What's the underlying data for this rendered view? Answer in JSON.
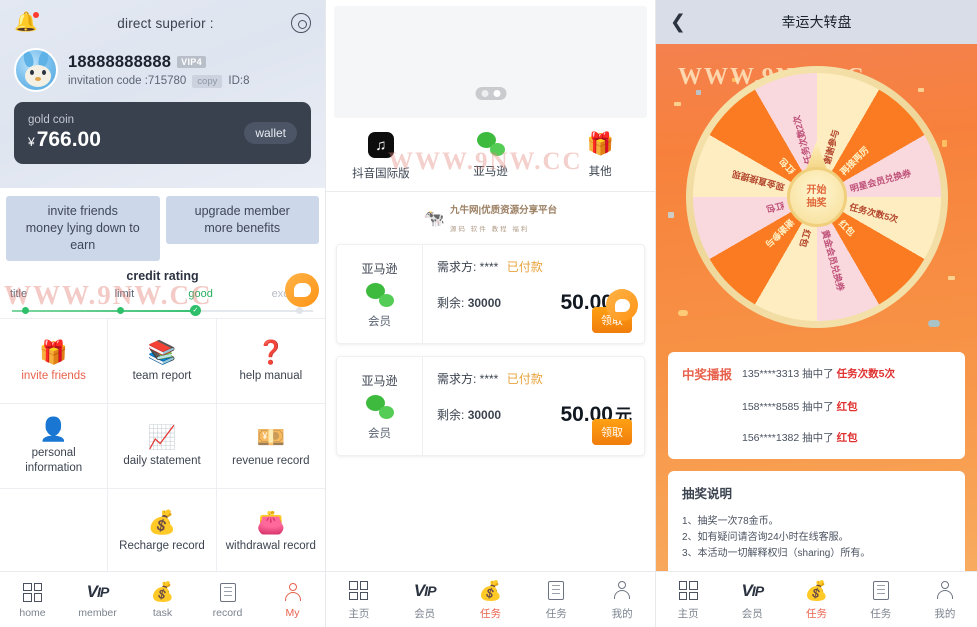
{
  "panel1": {
    "topbar": {
      "title": "direct superior :",
      "bell_icon": "bell-icon",
      "gear_icon": "gear-icon"
    },
    "user": {
      "phone": "18888888888",
      "vip_badge": "VIP4",
      "invitation_label": "invitation code :715780",
      "copy_label": "copy",
      "id_label": "ID:8"
    },
    "coin": {
      "label": "gold coin",
      "currency": "¥",
      "amount": "766.00",
      "wallet_label": "wallet"
    },
    "promos": [
      "invite friends\nmoney lying down to earn",
      "upgrade member\nmore benefits"
    ],
    "promo_a_line1": "invite friends",
    "promo_a_line2": "money lying down to",
    "promo_a_line3": "earn",
    "promo_b_line1": "upgrade member",
    "promo_b_line2": "more benefits",
    "credit": {
      "title": "credit rating",
      "ticks": [
        "title",
        "limit",
        "good",
        "excellent"
      ],
      "good_color": "#27ae60"
    },
    "grid": [
      {
        "label": "invite friends",
        "icon": "gift-icon",
        "glyph": "🎁",
        "highlight": true
      },
      {
        "label": "team report",
        "icon": "layers-icon",
        "glyph": "📚",
        "highlight": false
      },
      {
        "label": "help manual",
        "icon": "question-icon",
        "glyph": "❓",
        "highlight": false
      },
      {
        "label": "personal information",
        "icon": "id-card-icon",
        "glyph": "🪪",
        "highlight": false
      },
      {
        "label": "daily statement",
        "icon": "bar-chart-icon",
        "glyph": "📈",
        "highlight": false
      },
      {
        "label": "revenue record",
        "icon": "yen-book-icon",
        "glyph": "💴",
        "highlight": false
      },
      {
        "label": "",
        "icon": "blank-icon",
        "glyph": "",
        "highlight": false
      },
      {
        "label": "Recharge record",
        "icon": "money-bag-icon",
        "glyph": "💰",
        "highlight": false
      },
      {
        "label": "withdrawal record",
        "icon": "wallet-icon",
        "glyph": "👛",
        "highlight": false
      }
    ],
    "tabs": [
      {
        "label": "home",
        "icon": "grid-icon",
        "active": false
      },
      {
        "label": "member",
        "icon": "vip-icon",
        "active": false
      },
      {
        "label": "task",
        "icon": "money-bag-icon",
        "active": false
      },
      {
        "label": "record",
        "icon": "clipboard-icon",
        "active": false
      },
      {
        "label": "My",
        "icon": "person-icon",
        "active": true
      }
    ],
    "watermark": "WWW.9NW.CC",
    "brand": {
      "name": "九牛网|优质资源分享平台",
      "sub": "源码 软件 教程 福利"
    }
  },
  "panel2": {
    "carousel": {
      "dots": 2,
      "active_index": 1
    },
    "apps": [
      {
        "label": "抖音国际版",
        "icon": "tiktok-icon"
      },
      {
        "label": "亚马逊",
        "icon": "wechat-icon"
      },
      {
        "label": "其他",
        "icon": "gift-icon"
      }
    ],
    "brand": {
      "name": "九牛网|优质资源分享平台",
      "sub": "源码 软件 教程 福利"
    },
    "watermark": "WWW.9NW.CC",
    "tasks": [
      {
        "platform": "亚马逊",
        "platform_icon": "wechat-icon",
        "member_label": "会员",
        "demander_label": "需求方: ****",
        "paid_label": "已付款",
        "remaining_label": "剩余:",
        "remaining_value": "30000",
        "price": "50.00",
        "unit": "元",
        "claim_label": "领取"
      },
      {
        "platform": "亚马逊",
        "platform_icon": "wechat-icon",
        "member_label": "会员",
        "demander_label": "需求方: ****",
        "paid_label": "已付款",
        "remaining_label": "剩余:",
        "remaining_value": "30000",
        "price": "50.00",
        "unit": "元",
        "claim_label": "领取"
      }
    ],
    "tabs": [
      {
        "label": "主页",
        "icon": "grid-icon",
        "active": false
      },
      {
        "label": "会员",
        "icon": "vip-icon",
        "active": false
      },
      {
        "label": "任务",
        "icon": "money-bag-icon",
        "active": true
      },
      {
        "label": "任务",
        "icon": "clipboard-icon",
        "active": false
      },
      {
        "label": "我的",
        "icon": "person-icon",
        "active": false
      }
    ]
  },
  "panel3": {
    "header": {
      "back_icon": "chevron-left-icon",
      "title": "幸运大转盘"
    },
    "watermark": "WWW.9NW.CC",
    "wheel": {
      "center_line1": "开始",
      "center_line2": "抽奖",
      "segments": [
        "谢谢参与",
        "再接再厉",
        "明星会员兑换券",
        "任务次数5次",
        "红包",
        "黄金会员兑换券",
        "红包",
        "谢谢参与",
        "红包",
        "现金直接提现",
        "红包",
        "任务次数2次"
      ]
    },
    "broadcast": {
      "title": "中奖播报",
      "rows": [
        {
          "phone": "135****3313",
          "verb": "抽中了",
          "prize": "任务次数5次"
        },
        {
          "phone": "158****8585",
          "verb": "抽中了",
          "prize": "红包"
        },
        {
          "phone": "156****1382",
          "verb": "抽中了",
          "prize": "红包"
        }
      ]
    },
    "rules": {
      "title": "抽奖说明",
      "items": [
        "1、抽奖一次78金币。",
        "2、如有疑问请咨询24小时在线客服。",
        "3、本活动一切解释权归（sharing）所有。"
      ]
    },
    "tabs": [
      {
        "label": "主页",
        "icon": "grid-icon",
        "active": false
      },
      {
        "label": "会员",
        "icon": "vip-icon",
        "active": false
      },
      {
        "label": "任务",
        "icon": "money-bag-icon",
        "active": true
      },
      {
        "label": "任务",
        "icon": "clipboard-icon",
        "active": false
      },
      {
        "label": "我的",
        "icon": "person-icon",
        "active": false
      }
    ]
  }
}
